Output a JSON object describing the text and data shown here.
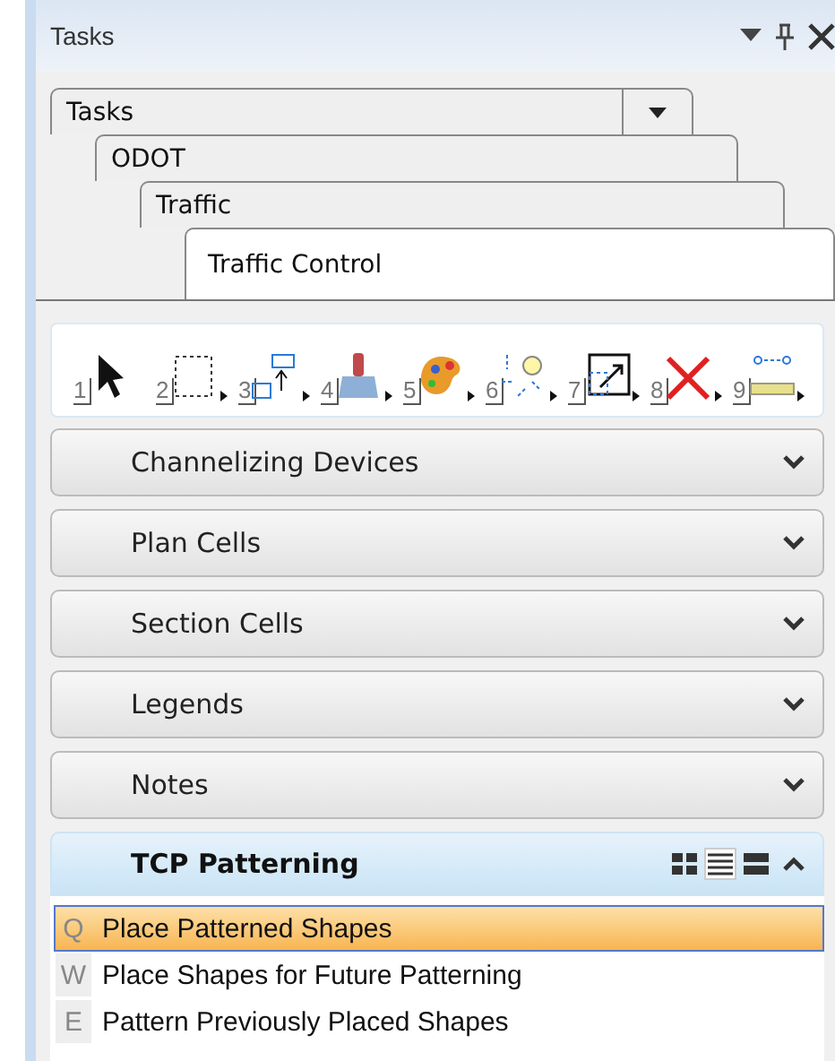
{
  "window": {
    "title": "Tasks"
  },
  "breadcrumbs": [
    {
      "label": "Tasks",
      "has_dropdown": true,
      "selected": false
    },
    {
      "label": "ODOT",
      "has_dropdown": false,
      "selected": false
    },
    {
      "label": "Traffic",
      "has_dropdown": false,
      "selected": false
    },
    {
      "label": "Traffic Control",
      "has_dropdown": false,
      "selected": true
    }
  ],
  "tools": [
    {
      "key": "1",
      "kind": "select",
      "has_menu": false
    },
    {
      "key": "2",
      "kind": "fence",
      "has_menu": true
    },
    {
      "key": "3",
      "kind": "move",
      "has_menu": true
    },
    {
      "key": "4",
      "kind": "brush",
      "has_menu": true
    },
    {
      "key": "5",
      "kind": "palette",
      "has_menu": true
    },
    {
      "key": "6",
      "kind": "bulb",
      "has_menu": true
    },
    {
      "key": "7",
      "kind": "scale",
      "has_menu": true
    },
    {
      "key": "8",
      "kind": "delete",
      "has_menu": true
    },
    {
      "key": "9",
      "kind": "measure",
      "has_menu": true
    }
  ],
  "sections": [
    {
      "title": "Channelizing Devices",
      "expanded": false
    },
    {
      "title": "Plan Cells",
      "expanded": false
    },
    {
      "title": "Section Cells",
      "expanded": false
    },
    {
      "title": "Legends",
      "expanded": false
    },
    {
      "title": "Notes",
      "expanded": false
    },
    {
      "title": "TCP Patterning",
      "expanded": true,
      "views": [
        {
          "kind": "icons",
          "selected": false
        },
        {
          "kind": "list",
          "selected": true
        },
        {
          "kind": "details",
          "selected": false
        }
      ],
      "items": [
        {
          "key": "Q",
          "label": "Place Patterned Shapes",
          "selected": true
        },
        {
          "key": "W",
          "label": "Place Shapes for Future Patterning",
          "selected": false
        },
        {
          "key": "E",
          "label": "Pattern Previously Placed Shapes",
          "selected": false
        }
      ]
    }
  ]
}
